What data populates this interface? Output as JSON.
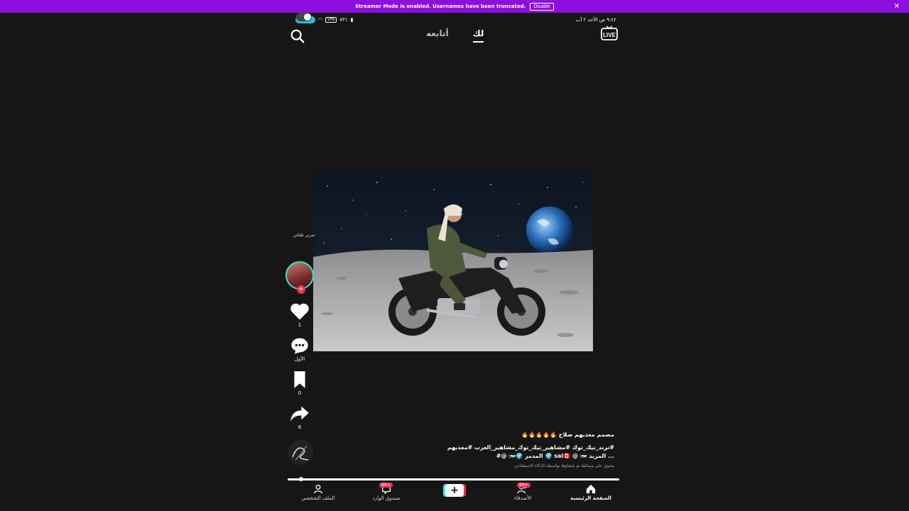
{
  "banner": {
    "text": "Streamer Mode is enabled. Usernames have been truncated.",
    "disable_label": "Disable",
    "close_glyph": "×"
  },
  "status_bar": {
    "battery": "٧٣٪",
    "vpn": "VPN",
    "time_date": "٩:٤٢ ص  الأحد ٢ آب"
  },
  "top_nav": {
    "tabs": [
      {
        "label": "لك",
        "active": true
      },
      {
        "label": "أتابعه",
        "active": false
      }
    ],
    "live_label": "LIVE"
  },
  "rail": {
    "autoscroll_label": "تمرير تلقائي",
    "likes": "1",
    "comments": "الأول",
    "saves": "0",
    "shares": "6"
  },
  "caption": {
    "title": "مصمم معذبهم صلاح 🔥🔥🔥🔥🔥",
    "tags_line1": "#ترند_تيك_توك #مشاهير_تيك_توك_مشاهير_العرب #معذبهم",
    "tags_line2": "... المزيد sal🇨🇦 @ 🇵🇸 🌍 المدمر 🌍🇵🇸 @#",
    "ai_notice": "يحتوي على وسائط تم إنشاؤها بواسطة الذكاء الاصطناعي"
  },
  "bottom_nav": {
    "profile": "الملف الشخصي",
    "inbox": "صندوق الوارد",
    "inbox_badge": "99+",
    "create": "+",
    "friends": "الأصدقاء",
    "friends_badge": "99+",
    "home": "الصفحة الرئيسية"
  },
  "colors": {
    "banner": "#8c0fe0",
    "accent_pink": "#fe2c55",
    "accent_cyan": "#25f4ee",
    "status_pill": "#2bbcd8"
  }
}
